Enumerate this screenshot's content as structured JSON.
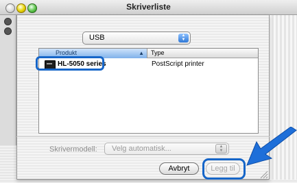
{
  "window": {
    "title": "Skriverliste"
  },
  "connection": {
    "selected": "USB"
  },
  "printer_list": {
    "columns": [
      "Produkt",
      "Type"
    ],
    "rows": [
      {
        "product": "HL-5050 series",
        "type": "PostScript printer"
      }
    ]
  },
  "model": {
    "label": "Skrivermodell:",
    "selected": "Velg automatisk..."
  },
  "buttons": {
    "cancel": "Avbryt",
    "add": "Legg til"
  },
  "colors": {
    "highlight": "#1565c8",
    "arrow": "#1e6fd9"
  }
}
